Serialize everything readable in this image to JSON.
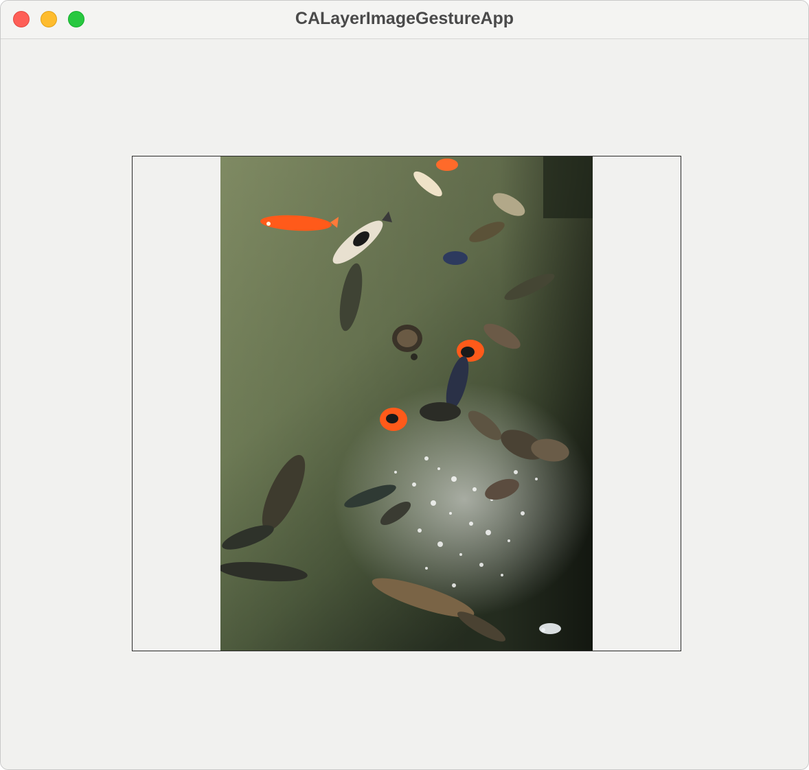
{
  "window": {
    "title": "CALayerImageGestureApp"
  },
  "titlebar_buttons": {
    "close": {
      "icon": "close-icon",
      "color": "#fe5f57"
    },
    "minimize": {
      "icon": "minimize-icon",
      "color": "#febc2e"
    },
    "zoom": {
      "icon": "zoom-icon",
      "color": "#28c840"
    }
  },
  "image_layer": {
    "image_content": "koi-pond-photo"
  },
  "colors": {
    "window_background": "#f1f1ef",
    "layer_border": "#2b2b2b",
    "pond_water": "#6e7a55"
  }
}
